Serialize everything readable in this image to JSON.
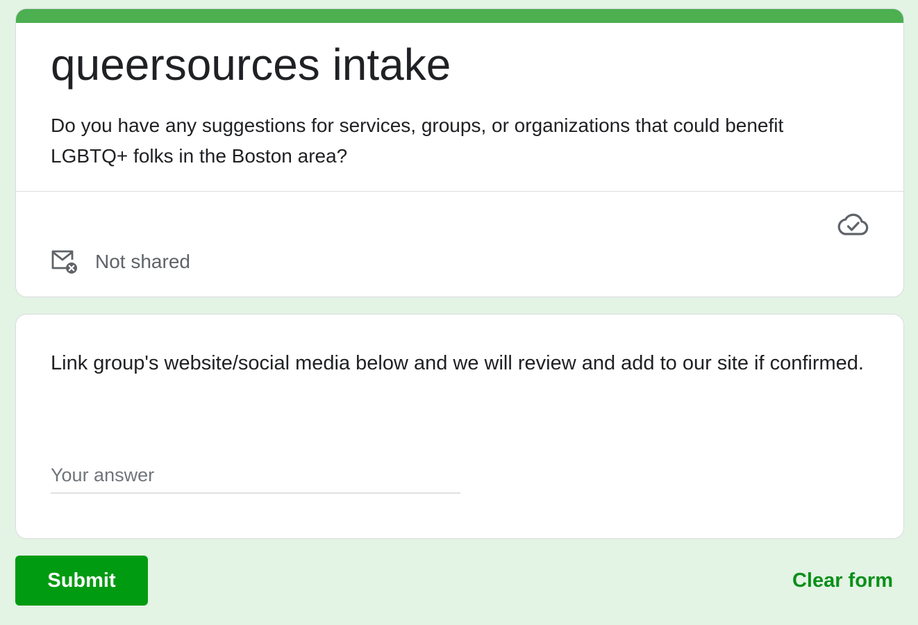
{
  "form": {
    "title": "queersources intake",
    "description": "Do you have any suggestions for services, groups, or organizations that could benefit LGBTQ+ folks in the Boston area?",
    "accent_color": "#4caf50",
    "email_status": "Not shared",
    "email_status_icon": "mail-x-icon",
    "save_status_icon": "cloud-check-icon"
  },
  "question": {
    "text": "Link group's website/social media below and we will review and add to our site if confirmed.",
    "answer_placeholder": "Your answer",
    "answer_value": ""
  },
  "actions": {
    "submit_label": "Submit",
    "clear_label": "Clear form",
    "submit_color": "#019b12"
  }
}
